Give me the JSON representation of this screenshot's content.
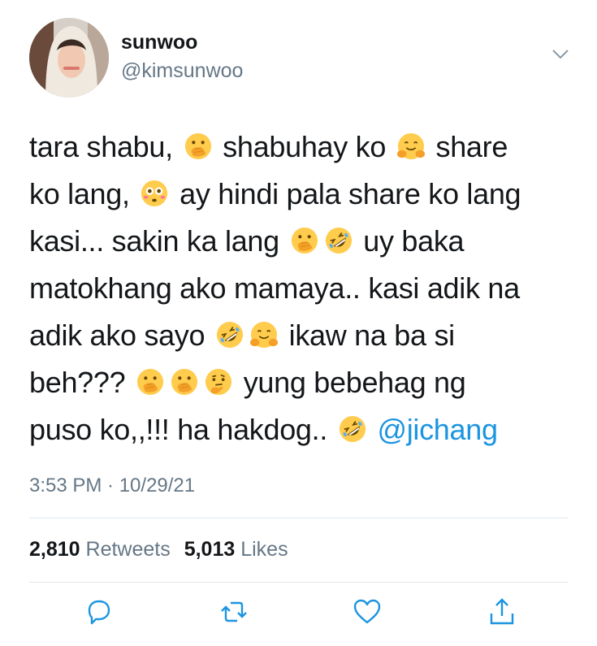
{
  "author": {
    "display_name": "sunwoo",
    "handle": "@kimsunwoo"
  },
  "tweet": {
    "lines": [
      [
        {
          "t": "text",
          "v": "tara shabu, "
        },
        {
          "t": "emoji",
          "v": "hand-over-mouth"
        },
        {
          "t": "text",
          "v": " shabuhay ko "
        },
        {
          "t": "emoji",
          "v": "hugging"
        },
        {
          "t": "text",
          "v": " share"
        }
      ],
      [
        {
          "t": "text",
          "v": "ko lang, "
        },
        {
          "t": "emoji",
          "v": "flushed"
        },
        {
          "t": "text",
          "v": " ay hindi pala share ko lang"
        }
      ],
      [
        {
          "t": "text",
          "v": "kasi... sakin ka lang "
        },
        {
          "t": "emoji",
          "v": "hand-over-mouth"
        },
        {
          "t": "emoji",
          "v": "rofl"
        },
        {
          "t": "text",
          "v": " uy baka"
        }
      ],
      [
        {
          "t": "text",
          "v": "matokhang ako mamaya.. kasi adik na"
        }
      ],
      [
        {
          "t": "text",
          "v": "adik ako sayo "
        },
        {
          "t": "emoji",
          "v": "rofl"
        },
        {
          "t": "emoji",
          "v": "hugging"
        },
        {
          "t": "text",
          "v": " ikaw na ba si"
        }
      ],
      [
        {
          "t": "text",
          "v": "beh??? "
        },
        {
          "t": "emoji",
          "v": "hand-over-mouth"
        },
        {
          "t": "emoji",
          "v": "hand-over-mouth"
        },
        {
          "t": "emoji",
          "v": "thinking"
        },
        {
          "t": "text",
          "v": " yung bebehag ng"
        }
      ],
      [
        {
          "t": "text",
          "v": "puso ko,,!!! ha hakdog.. "
        },
        {
          "t": "emoji",
          "v": "rofl"
        },
        {
          "t": "text",
          "v": " "
        },
        {
          "t": "mention",
          "v": "@jichang"
        }
      ]
    ]
  },
  "timestamp": "3:53 PM · 10/29/21",
  "stats": {
    "retweets_count": "2,810",
    "retweets_label": "Retweets",
    "likes_count": "5,013",
    "likes_label": "Likes"
  },
  "colors": {
    "text": "#14171a",
    "secondary": "#657786",
    "link": "#1b95e0",
    "divider": "#e1e8ed"
  },
  "icons": [
    "chevron-down-icon",
    "reply-icon",
    "retweet-icon",
    "like-icon",
    "share-icon"
  ]
}
